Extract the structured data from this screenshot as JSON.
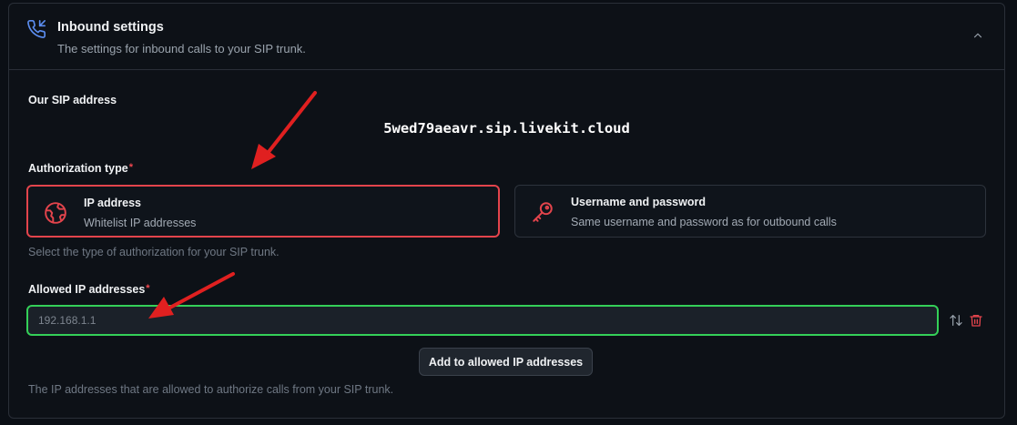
{
  "header": {
    "title": "Inbound settings",
    "subtitle": "The settings for inbound calls to your SIP trunk.",
    "icon": "phone-incoming-icon"
  },
  "sip": {
    "label": "Our SIP address",
    "address": "5wed79aeavr.sip.livekit.cloud"
  },
  "auth": {
    "label": "Authorization type",
    "required_mark": "*",
    "options": [
      {
        "title": "IP address",
        "description": "Whitelist IP addresses",
        "icon": "globe-icon",
        "selected": true
      },
      {
        "title": "Username and password",
        "description": "Same username and password as for outbound calls",
        "icon": "key-icon",
        "selected": false
      }
    ],
    "helper": "Select the type of authorization for your SIP trunk."
  },
  "allowed_ips": {
    "label": "Allowed IP addresses",
    "required_mark": "*",
    "placeholder": "192.168.1.1",
    "value": "",
    "add_button": "Add to allowed IP addresses",
    "helper": "The IP addresses that are allowed to authorize calls from your SIP trunk."
  },
  "colors": {
    "accent_red": "#e3444c",
    "valid_green": "#34d058",
    "annotation_arrow": "#e02020"
  }
}
